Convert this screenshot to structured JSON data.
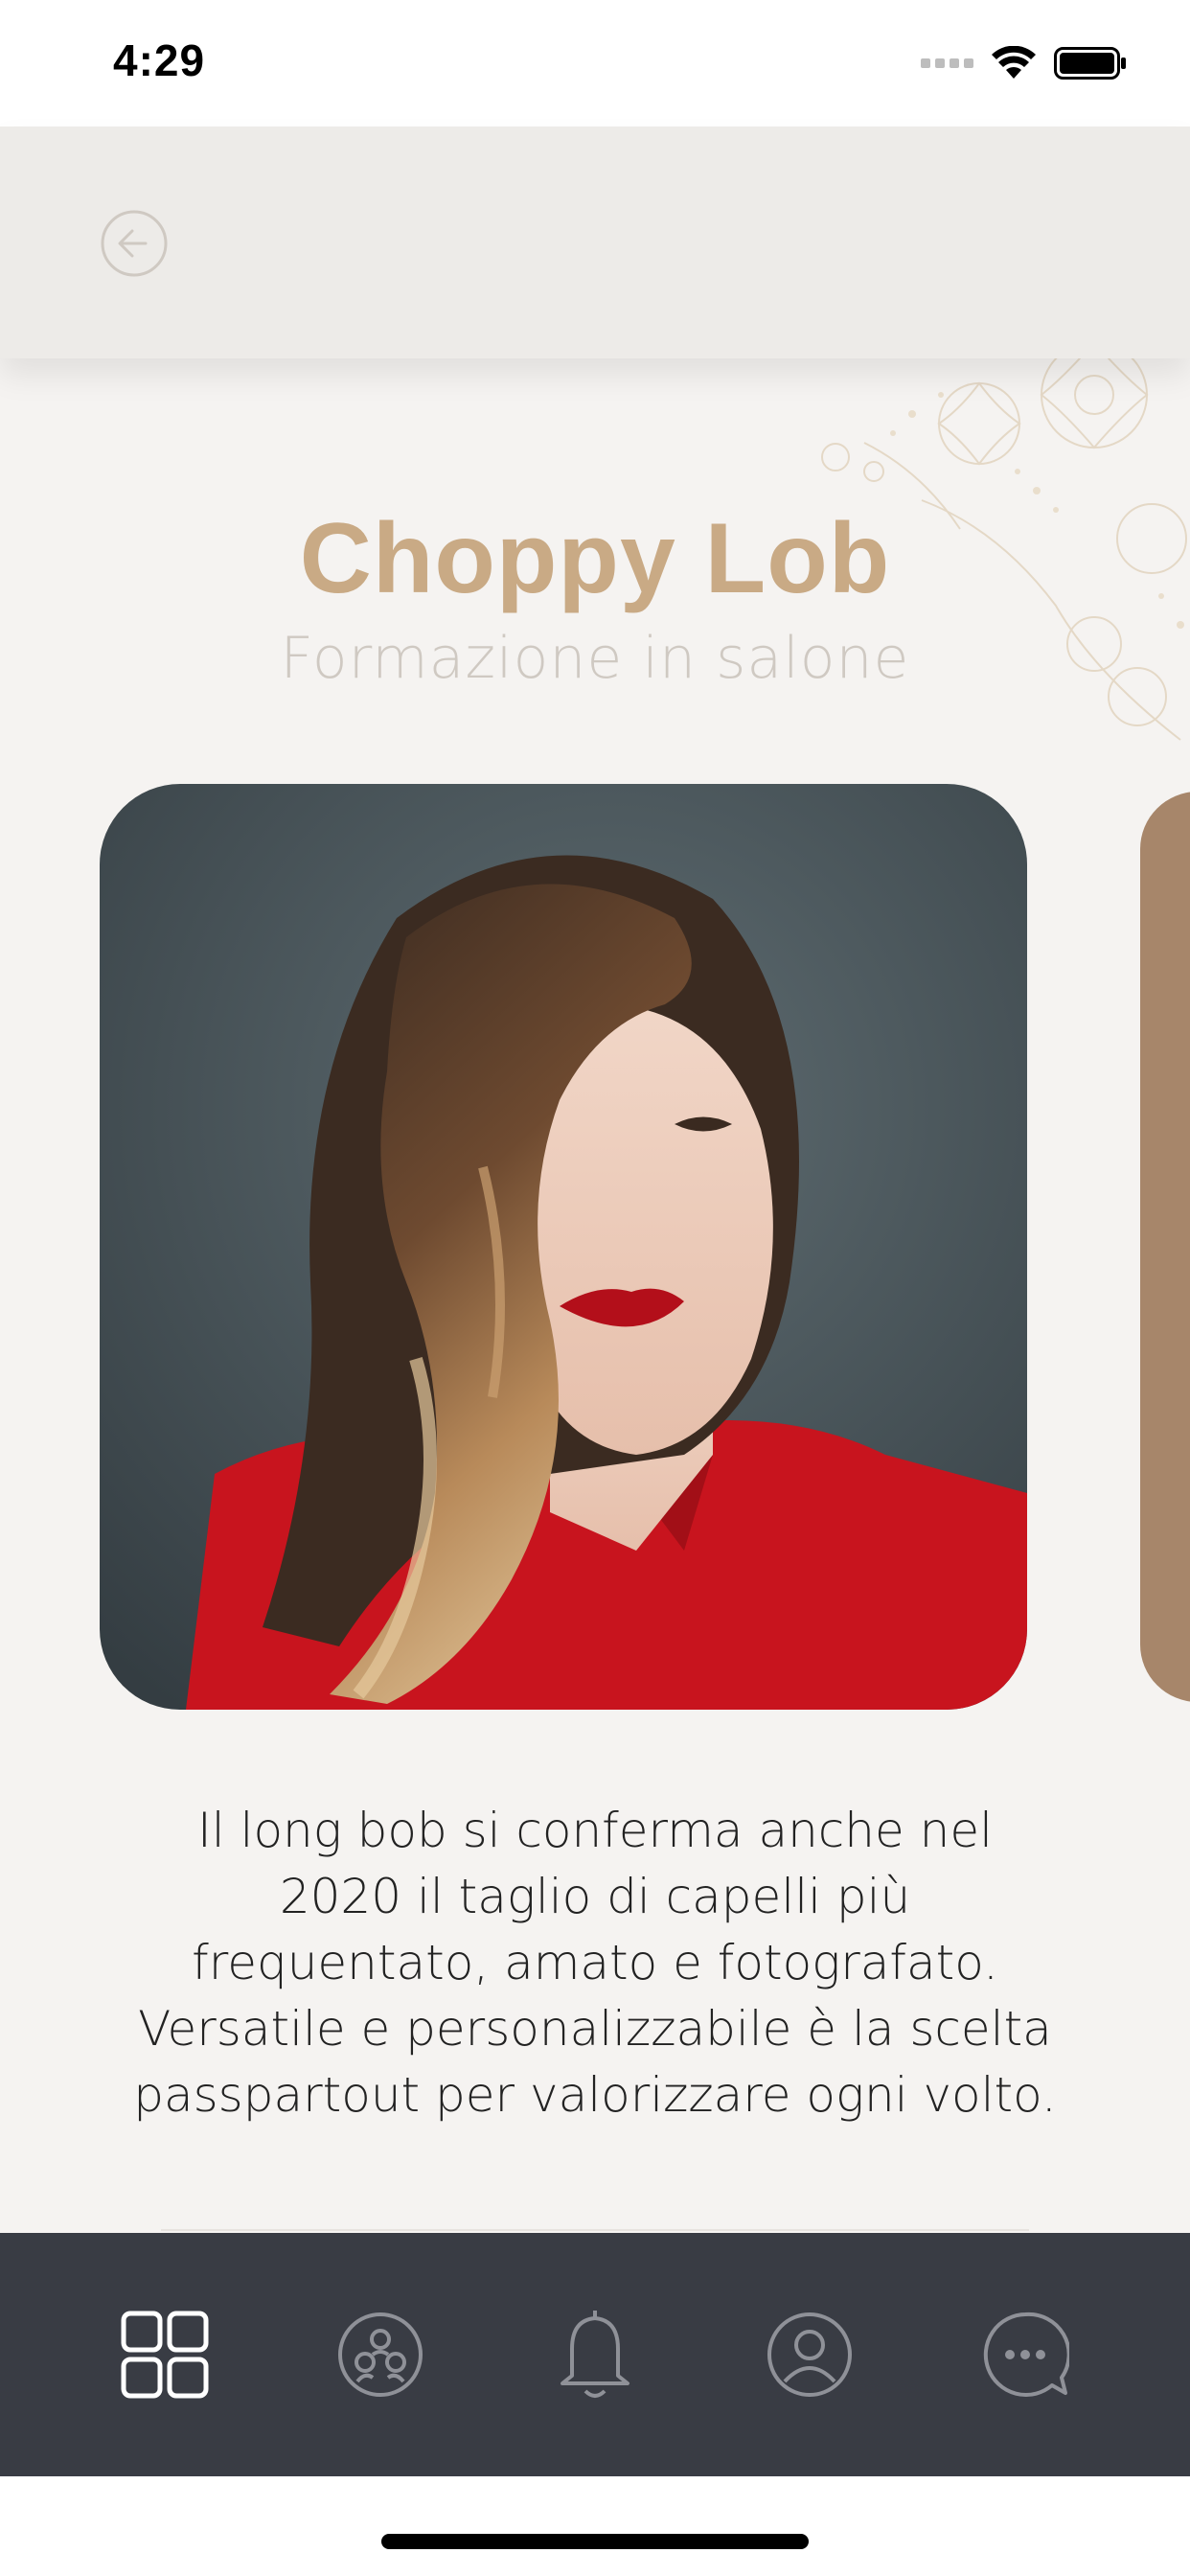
{
  "status_bar": {
    "time": "4:29",
    "icons": [
      "signal-icon",
      "wifi-icon",
      "battery-icon"
    ]
  },
  "header": {
    "back_icon": "back-arrow-circle-icon"
  },
  "hero": {
    "title": "Choppy Lob",
    "subtitle": "Formazione in salone",
    "description_lines": [
      "Il long bob si conferma anche nel",
      "2020 il taglio di capelli più",
      "frequentato, amato e fotografato.",
      "Versatile e personalizzabile è la scelta",
      "passpartout per valorizzare ogni volto."
    ]
  },
  "gallery": {
    "images": [
      {
        "alt_icon": "hairstyle-photo"
      },
      {
        "alt_icon": "hairstyle-photo-next"
      }
    ]
  },
  "tab_bar": {
    "tabs": [
      {
        "icon": "grid-icon",
        "active": true
      },
      {
        "icon": "community-icon",
        "active": false
      },
      {
        "icon": "bell-icon",
        "active": false
      },
      {
        "icon": "profile-icon",
        "active": false
      },
      {
        "icon": "chat-icon",
        "active": false
      }
    ]
  },
  "colors": {
    "accent": "#c9aa85",
    "subtitle": "#cfc9c2",
    "tab_bar": "#393c44",
    "header": "#edebe8",
    "background": "#f5f3f1"
  }
}
